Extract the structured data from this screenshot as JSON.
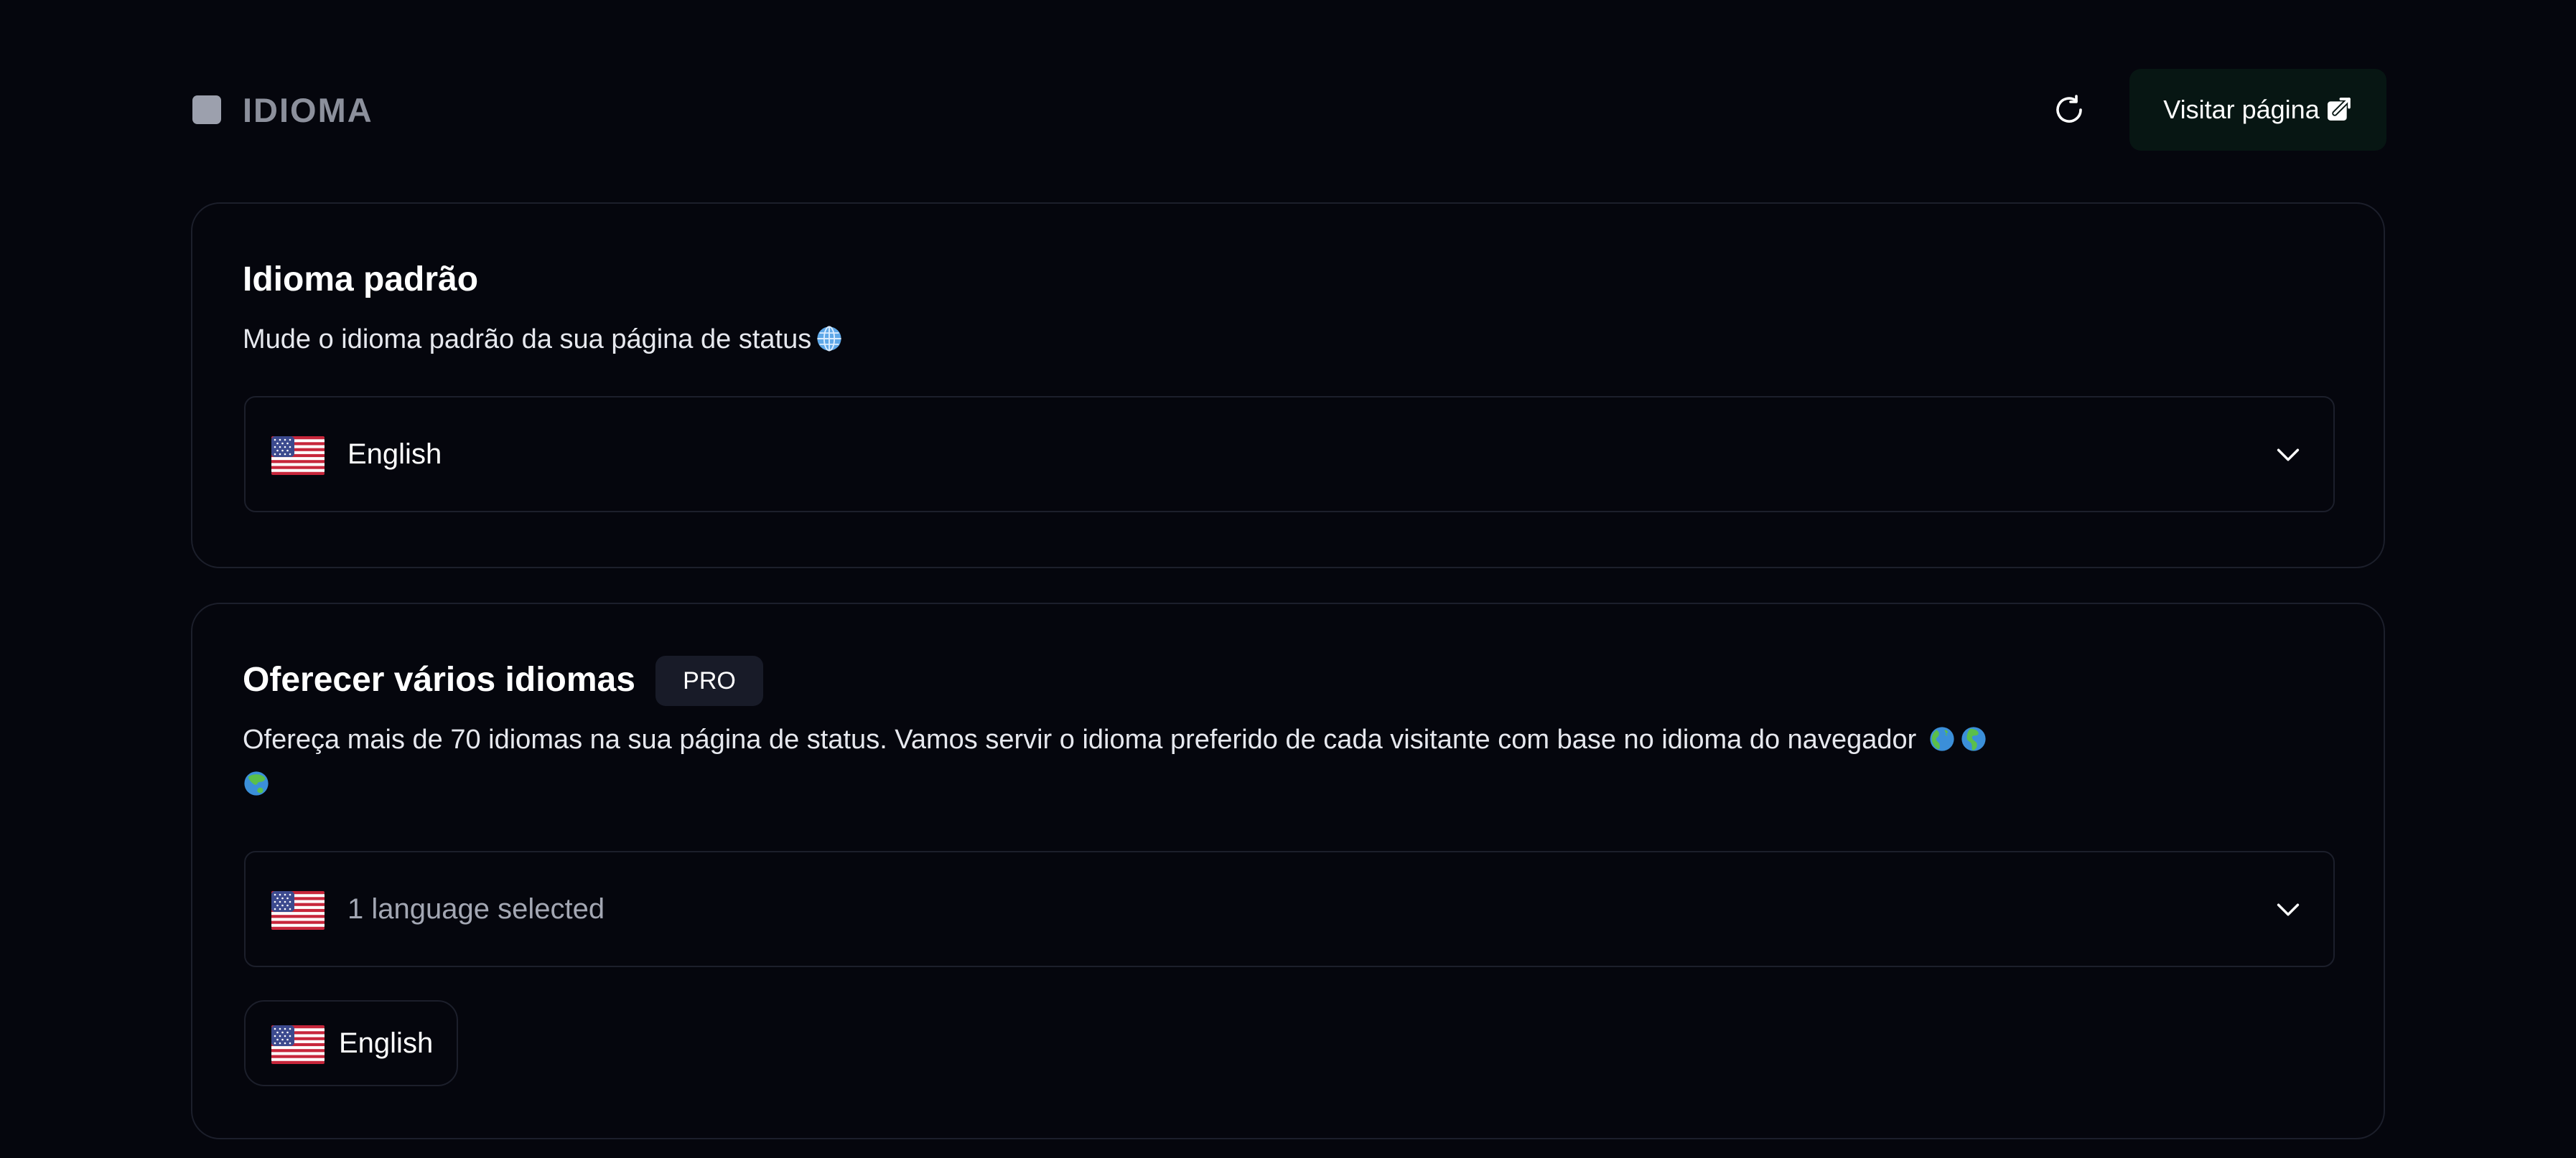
{
  "header": {
    "title": "IDIOMA",
    "refresh_icon": "refresh-icon",
    "visit_label": "Visitar página",
    "visit_icon": "external-link-icon"
  },
  "default_language": {
    "title": "Idioma padrão",
    "description": "Mude o idioma padrão da sua página de status",
    "description_icon": "globe-meridians-emoji",
    "select": {
      "flag_icon": "us-flag-icon",
      "value": "English"
    }
  },
  "multi_language": {
    "title": "Oferecer vários idiomas",
    "badge": "PRO",
    "description": "Ofereça mais de 70 idiomas na sua página de status. Vamos servir o idioma preferido de cada visitante com base no idioma do navegador",
    "description_icons": [
      "globe-americas-emoji",
      "globe-europe-africa-emoji",
      "globe-asia-australia-emoji"
    ],
    "select": {
      "flag_icon": "us-flag-icon",
      "value": "1 language selected"
    },
    "selected_chips": [
      {
        "flag_icon": "us-flag-icon",
        "label": "English"
      }
    ]
  },
  "colors": {
    "background": "#05060d",
    "card_border": "#1c1f2b",
    "visit_button_bg": "#071613",
    "badge_bg": "#181b28",
    "title_muted": "#8c909c"
  }
}
